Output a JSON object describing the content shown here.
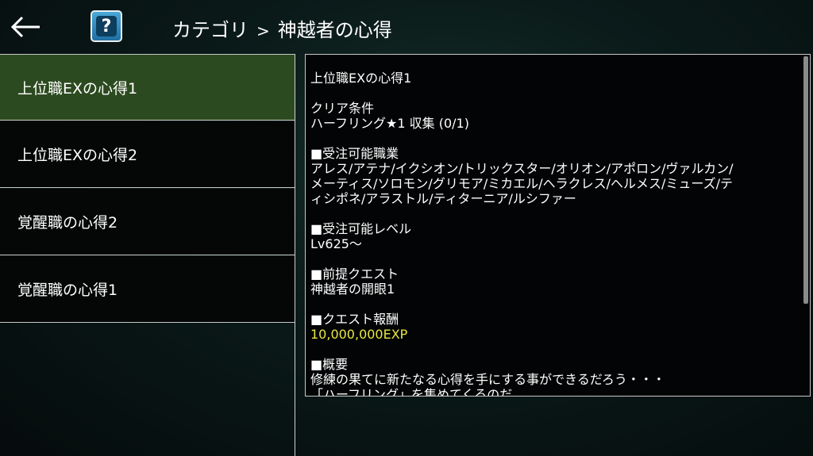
{
  "header": {
    "back_icon": "arrow-left-icon",
    "help_icon": "question-mark-icon",
    "help_label": "?",
    "breadcrumb": {
      "category": "カテゴリ",
      "separator": ">",
      "current": "神越者の心得"
    }
  },
  "quest_list": {
    "items": [
      {
        "label": "上位職EXの心得1",
        "selected": true
      },
      {
        "label": "上位職EXの心得2",
        "selected": false
      },
      {
        "label": "覚醒職の心得2",
        "selected": false
      },
      {
        "label": "覚醒職の心得1",
        "selected": false
      }
    ]
  },
  "detail": {
    "title": "上位職EXの心得1",
    "clear_condition_heading": "クリア条件",
    "clear_condition": "ハーフリング★1 収集 (0/1)",
    "jobs_heading": "■受注可能職業",
    "jobs_lines": [
      "アレス/アテナ/イクシオン/トリックスター/オリオン/アポロン/ヴァルカン/",
      "メーティス/ソロモン/グリモア/ミカエル/ヘラクレス/ヘルメス/ミューズ/テ",
      "ィシポネ/アラストル/ティターニア/ルシファー"
    ],
    "level_heading": "■受注可能レベル",
    "level": "Lv625～",
    "prereq_heading": "■前提クエスト",
    "prereq": "神越者の開眼1",
    "reward_heading": "■クエスト報酬",
    "reward": "10,000,000EXP",
    "summary_heading": "■概要",
    "summary_lines": [
      "修練の果てに新たなる心得を手にする事ができるだろう・・・",
      "「ハーフリング」を集めてくるのだ"
    ]
  },
  "colors": {
    "selected_item": "#2c4a1f",
    "reward_text": "#e9e640",
    "help_button": "#2a86c0"
  }
}
